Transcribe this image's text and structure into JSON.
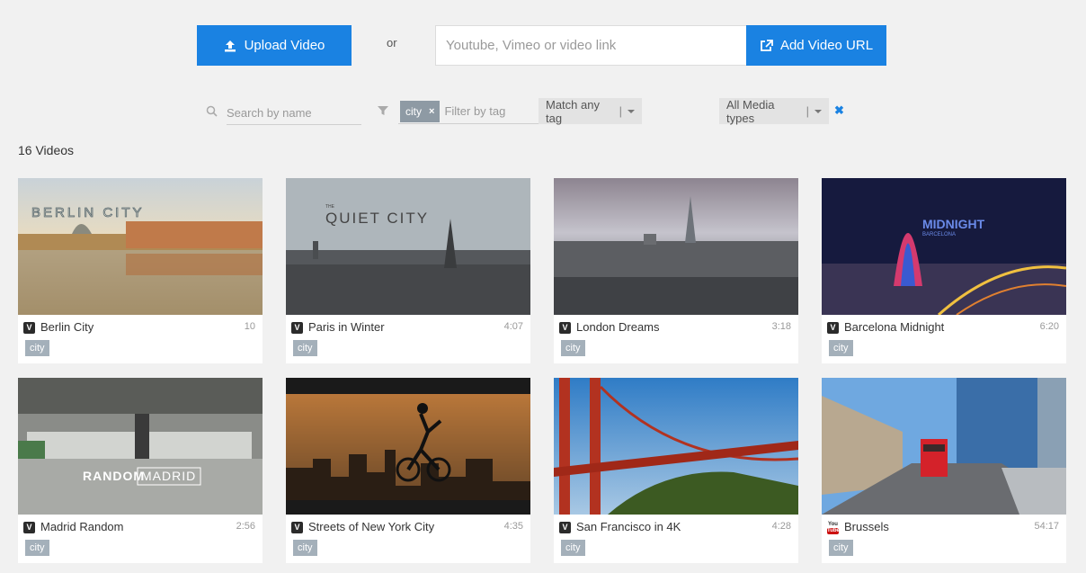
{
  "top": {
    "upload_label": "Upload Video",
    "or_label": "or",
    "url_placeholder": "Youtube, Vimeo or video link",
    "add_url_label": "Add Video URL"
  },
  "filters": {
    "search_placeholder": "Search by name",
    "active_tag": "city",
    "tag_remove": "×",
    "tag_placeholder": "Filter by tag",
    "match_label": "Match any tag",
    "media_label": "All Media types",
    "clear": "✖"
  },
  "count_label": "16 Videos",
  "videos": [
    {
      "title": "Berlin City",
      "duration": "10",
      "tag": "city",
      "source": "vimeo",
      "thumb_text": "BERLIN CITY"
    },
    {
      "title": "Paris in Winter",
      "duration": "4:07",
      "tag": "city",
      "source": "vimeo",
      "thumb_text": "QUIET CITY",
      "thumb_small": "THE"
    },
    {
      "title": "London Dreams",
      "duration": "3:18",
      "tag": "city",
      "source": "vimeo"
    },
    {
      "title": "Barcelona Midnight",
      "duration": "6:20",
      "tag": "city",
      "source": "vimeo",
      "thumb_text": "MIDNIGHT",
      "thumb_small": "BARCELONA"
    },
    {
      "title": "Madrid Random",
      "duration": "2:56",
      "tag": "city",
      "source": "vimeo",
      "thumb_text": "RANDOM",
      "thumb_text2": "MADRID"
    },
    {
      "title": "Streets of New York City",
      "duration": "4:35",
      "tag": "city",
      "source": "vimeo"
    },
    {
      "title": "San Francisco in 4K",
      "duration": "4:28",
      "tag": "city",
      "source": "vimeo"
    },
    {
      "title": "Brussels",
      "duration": "54:17",
      "tag": "city",
      "source": "youtube"
    }
  ],
  "icons": {
    "vimeo": "V",
    "youtube_top": "You",
    "youtube_bottom": "Tube"
  },
  "colors": {
    "accent": "#1a82e2",
    "tag_chip": "#8e9aa4",
    "card_tag": "#a4b0ba"
  }
}
